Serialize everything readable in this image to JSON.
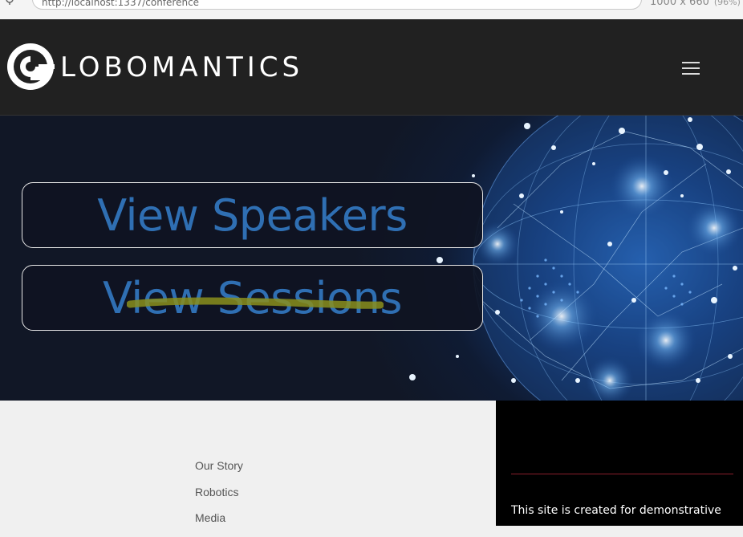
{
  "browser": {
    "url": "http://localhost:1337/conference",
    "viewport_size": "1000 x 660",
    "zoom": "(96%)"
  },
  "header": {
    "brand": "LOBOMANTICS",
    "menu_icon": "hamburger-icon"
  },
  "hero": {
    "buttons": [
      {
        "label": "View Speakers"
      },
      {
        "label": "View Sessions"
      }
    ]
  },
  "footer": {
    "links": [
      "Our Story",
      "Robotics",
      "Media"
    ],
    "note": "This site is created for demonstrative"
  },
  "colors": {
    "header_bg": "#212121",
    "button_text": "#2f6fb3",
    "footer_rule": "#8b1e2b",
    "footer_right_bg": "#000000"
  }
}
